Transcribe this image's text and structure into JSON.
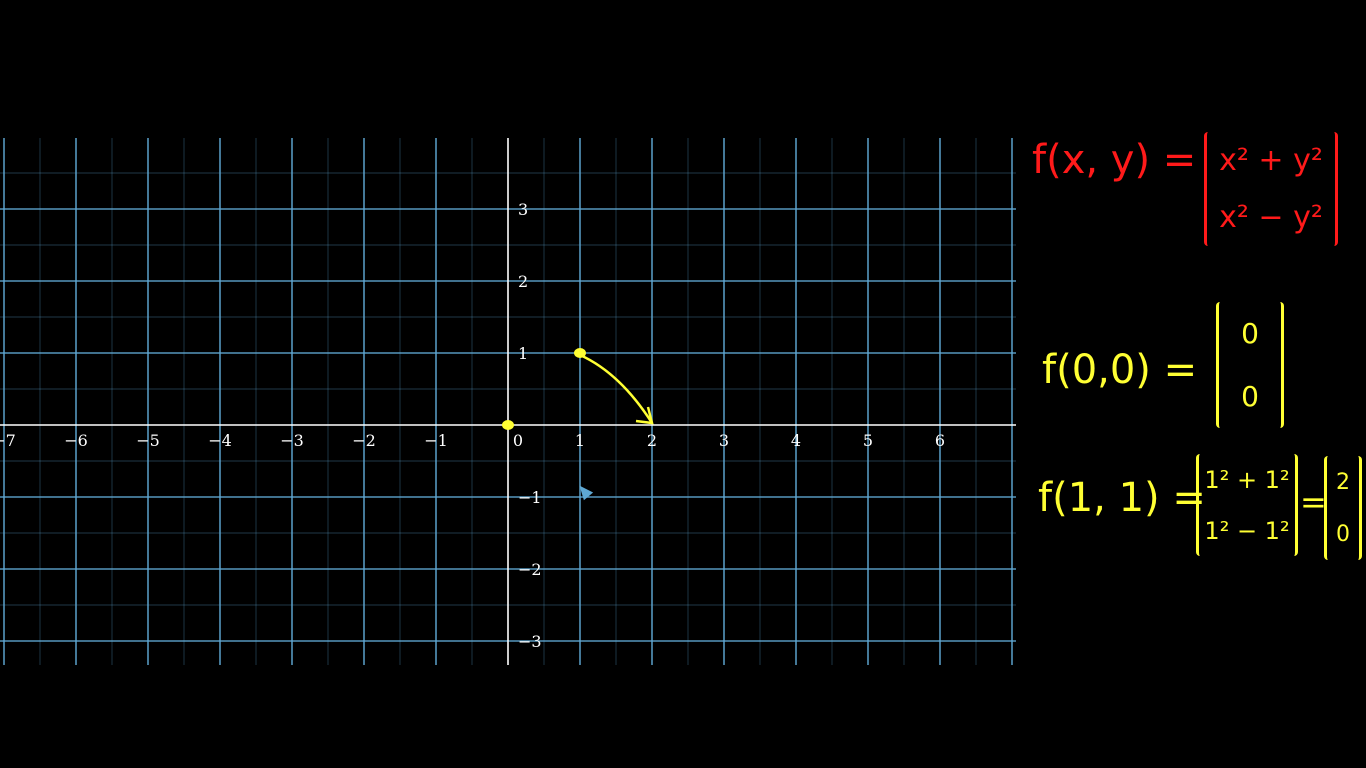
{
  "plane": {
    "axis_color": "#ffffff",
    "grid_color": "#5fa8d3",
    "x_ticks": [
      "−7",
      "−6",
      "−5",
      "−4",
      "−3",
      "−2",
      "−1",
      "0",
      "1",
      "2",
      "3",
      "4",
      "5",
      "6"
    ],
    "x_values": [
      -7,
      -6,
      -5,
      -4,
      -3,
      -2,
      -1,
      0,
      1,
      2,
      3,
      4,
      5,
      6
    ],
    "y_ticks": [
      "3",
      "2",
      "1",
      "−1",
      "−2",
      "−3"
    ],
    "y_values": [
      3,
      2,
      1,
      -1,
      -2,
      -3
    ]
  },
  "drawing": {
    "color": "#ffff33",
    "dot_origin": [
      0,
      0
    ],
    "dot_start": [
      1,
      1
    ],
    "arrow_from": [
      1,
      1
    ],
    "arrow_to": [
      2,
      0
    ]
  },
  "notes": {
    "definition": {
      "color": "#ff1a1a",
      "lhs": "f(x, y) =",
      "row1": "x² + y²",
      "row2": "x² − y²"
    },
    "eval_origin": {
      "color": "#ffff33",
      "lhs": "f(0,0) =",
      "row1": "0",
      "row2": "0"
    },
    "eval_one": {
      "color": "#ffff33",
      "lhs": "f(1, 1) =",
      "row1": "1² + 1²",
      "row2": "1² − 1²",
      "eq": "=",
      "res1": "2",
      "res2": "0"
    }
  },
  "cursor_icon": "pointer-cursor-icon"
}
